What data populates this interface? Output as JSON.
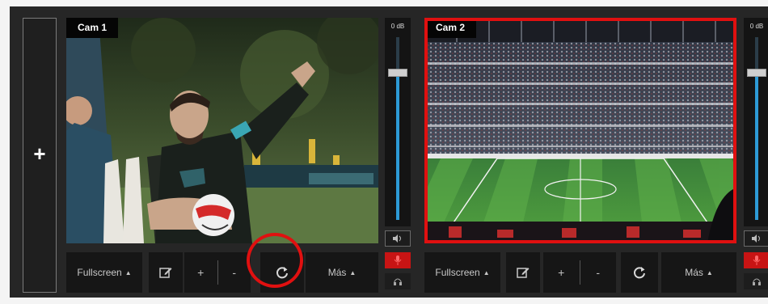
{
  "add_panel": {
    "label": "+"
  },
  "cameras": [
    {
      "label": "Cam 1",
      "fader": {
        "db_label": "0 dB",
        "level_fraction": 0.8
      },
      "toolbar": {
        "fullscreen": "Fullscreen",
        "plus": "+",
        "minus": "-",
        "more": "Más"
      }
    },
    {
      "label": "Cam 2",
      "live": true,
      "fader": {
        "db_label": "0 dB",
        "level_fraction": 0.8
      },
      "toolbar": {
        "fullscreen": "Fullscreen",
        "plus": "+",
        "minus": "-",
        "more": "Más"
      }
    }
  ],
  "colors": {
    "live_border": "#e01010",
    "fader_level": "#2d9ad6",
    "panel_bg": "#262626",
    "button_bg": "#161616"
  },
  "icons": [
    "edit-icon",
    "refresh-icon",
    "speaker-icon",
    "microphone-icon",
    "headphones-icon",
    "caret-up-icon"
  ]
}
